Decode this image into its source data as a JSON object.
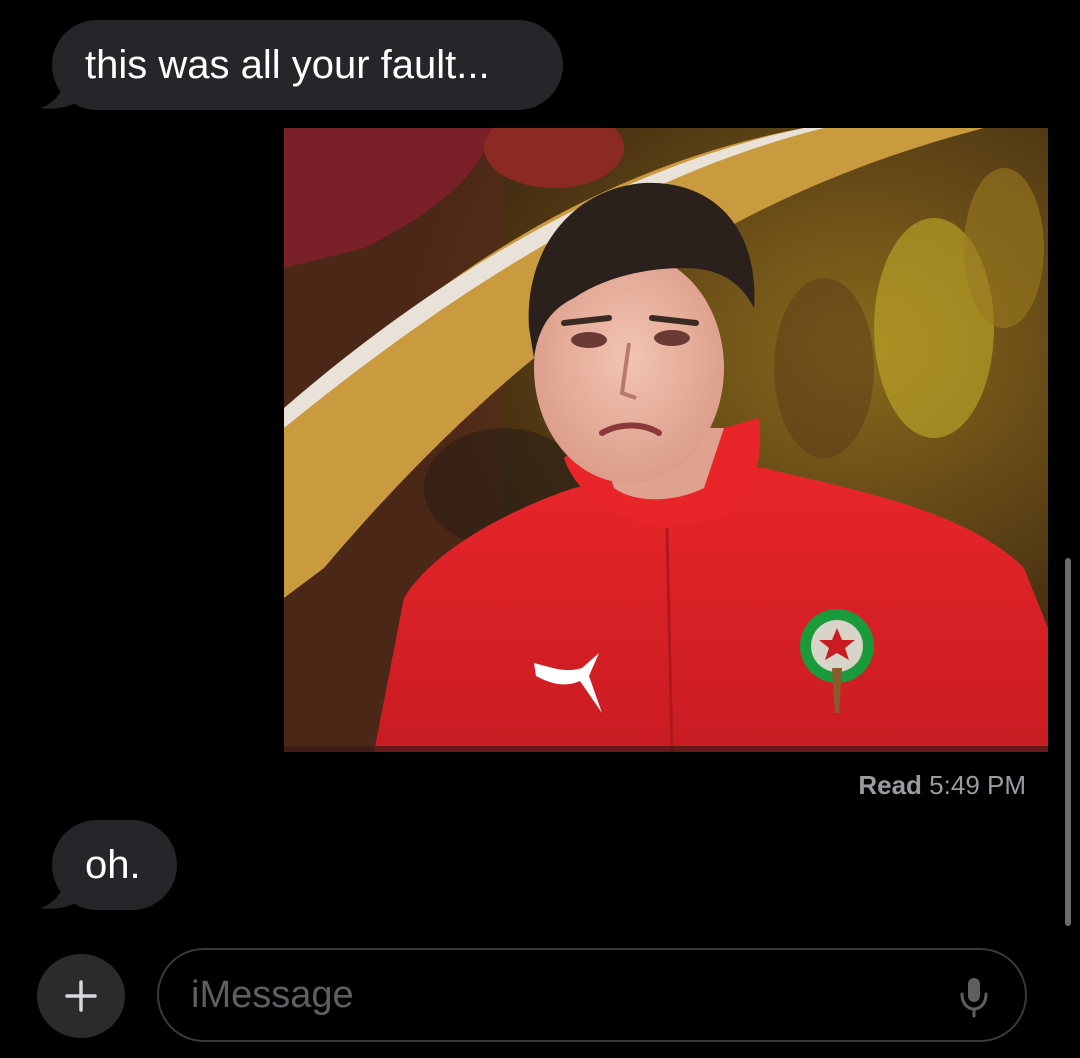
{
  "messages": [
    {
      "sender": "them",
      "type": "text",
      "text": "this was all your fault..."
    },
    {
      "sender": "me",
      "type": "image",
      "image": "photo of crying football player in red jacket"
    },
    {
      "sender": "them",
      "type": "text",
      "text": "oh."
    }
  ],
  "receipt": {
    "label": "Read",
    "time": "5:49 PM"
  },
  "composer": {
    "plus_icon": "plus-icon",
    "placeholder": "iMessage",
    "mic_icon": "microphone-icon"
  },
  "colors": {
    "background": "#000000",
    "incoming_bubble": "#26252a",
    "receipt_text": "#9a9aa0",
    "placeholder_text": "#5e5e63",
    "input_border": "#3a3a3c"
  }
}
